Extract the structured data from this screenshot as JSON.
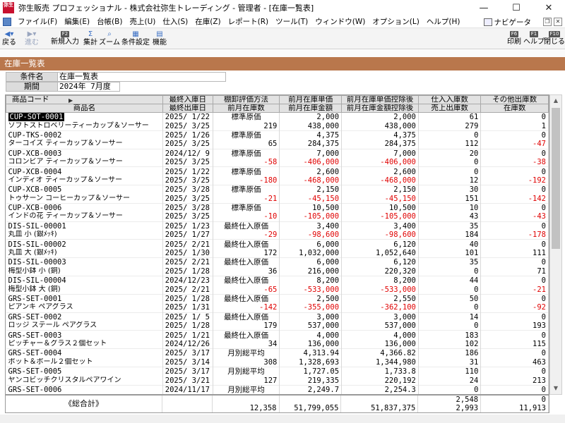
{
  "window": {
    "logo_text": "弥生",
    "title": "弥生販売 プロフェッショナル - 株式会社弥生トレーディング - 管理者 - [在庫一覧表]",
    "minimize": "—",
    "maximize": "☐",
    "close": "✕"
  },
  "menu": {
    "items": [
      "ファイル(F)",
      "編集(E)",
      "台帳(B)",
      "売上(U)",
      "仕入(S)",
      "在庫(Z)",
      "レポート(R)",
      "ツール(T)",
      "ウィンドウ(W)",
      "オプション(L)",
      "ヘルプ(H)"
    ],
    "navigator": "ナビゲータ"
  },
  "toolbar": {
    "back": "戻る",
    "forward": "進む",
    "new_key": "F2",
    "new_label": "新規入力",
    "total_label": "集計",
    "zoom_label": "ズーム",
    "cond_label": "条件設定",
    "func_label": "機能",
    "print_key": "F6",
    "print_label": "印刷",
    "help_key": "F1",
    "help_label": "ヘルプ",
    "close_key": "F10",
    "close_label": "閉じる"
  },
  "section": {
    "title": "在庫一覧表"
  },
  "conditions": {
    "name_label": "条件名",
    "name_value": "在庫一覧表",
    "period_label": "期間",
    "period_value": "2024年 7月度"
  },
  "headers": {
    "row1": [
      "商品コード",
      "最終入庫日",
      "棚卸評価方法",
      "前月在庫単価",
      "前月在庫単価控除後",
      "仕入入庫数",
      "その他出庫数"
    ],
    "row2": [
      "商品名",
      "最終出庫日",
      "前月在庫数",
      "前月在庫金額",
      "前月在庫金額控除後",
      "売上出庫数",
      "在庫数"
    ]
  },
  "rows": [
    {
      "code": "CUP-SOT-0001",
      "name": "ソフトストロベリーティーカップ＆ソーサー",
      "in_date": "2025/ 1/22",
      "out_date": "2025/ 3/25",
      "method": "標準原価",
      "qty": "219",
      "unit": "2,000",
      "amount": "438,000",
      "unit_after": "2,000",
      "amount_after": "438,000",
      "purchase": "61",
      "sales": "279",
      "other": "0",
      "stock": "1",
      "qty_neg": false,
      "amt_neg": false,
      "stock_neg": false
    },
    {
      "code": "CUP-TKS-0002",
      "name": "ターコイズ ティーカップ＆ソーサー",
      "in_date": "2025/ 1/26",
      "out_date": "2025/ 3/25",
      "method": "標準原価",
      "qty": "65",
      "unit": "4,375",
      "amount": "284,375",
      "unit_after": "4,375",
      "amount_after": "284,375",
      "purchase": "0",
      "sales": "112",
      "other": "0",
      "stock": "-47",
      "qty_neg": false,
      "amt_neg": false,
      "stock_neg": true
    },
    {
      "code": "CUP-XCB-0003",
      "name": "コロンビア ティーカップ＆ソーサー",
      "in_date": "2024/12/ 9",
      "out_date": "2025/ 3/25",
      "method": "標準原価",
      "qty": "-58",
      "unit": "7,000",
      "amount": "-406,000",
      "unit_after": "7,000",
      "amount_after": "-406,000",
      "purchase": "20",
      "sales": "0",
      "other": "0",
      "stock": "-38",
      "qty_neg": true,
      "amt_neg": true,
      "stock_neg": true
    },
    {
      "code": "CUP-XCB-0004",
      "name": "インディオ ティーカップ＆ソーサー",
      "in_date": "2025/ 1/22",
      "out_date": "2025/ 3/25",
      "method": "標準原価",
      "qty": "-180",
      "unit": "2,600",
      "amount": "-468,000",
      "unit_after": "2,600",
      "amount_after": "-468,000",
      "purchase": "0",
      "sales": "12",
      "other": "0",
      "stock": "-192",
      "qty_neg": true,
      "amt_neg": true,
      "stock_neg": true
    },
    {
      "code": "CUP-XCB-0005",
      "name": "トゥサーン コーヒーカップ＆ソーサー",
      "in_date": "2025/ 3/28",
      "out_date": "2025/ 3/25",
      "method": "標準原価",
      "qty": "-21",
      "unit": "2,150",
      "amount": "-45,150",
      "unit_after": "2,150",
      "amount_after": "-45,150",
      "purchase": "30",
      "sales": "151",
      "other": "0",
      "stock": "-142",
      "qty_neg": true,
      "amt_neg": true,
      "stock_neg": true
    },
    {
      "code": "CUP-XCB-0006",
      "name": "インドの花 ティーカップ＆ソーサー",
      "in_date": "2025/ 3/28",
      "out_date": "2025/ 3/25",
      "method": "標準原価",
      "qty": "-10",
      "unit": "10,500",
      "amount": "-105,000",
      "unit_after": "10,500",
      "amount_after": "-105,000",
      "purchase": "10",
      "sales": "43",
      "other": "0",
      "stock": "-43",
      "qty_neg": true,
      "amt_neg": true,
      "stock_neg": true
    },
    {
      "code": "DIS-SIL-00001",
      "name": "丸皿 小 (銀ﾒｯｷ)",
      "in_date": "2025/ 1/23",
      "out_date": "2025/ 1/27",
      "method": "最終仕入原価",
      "qty": "-29",
      "unit": "3,400",
      "amount": "-98,600",
      "unit_after": "3,400",
      "amount_after": "-98,600",
      "purchase": "35",
      "sales": "184",
      "other": "0",
      "stock": "-178",
      "qty_neg": true,
      "amt_neg": true,
      "stock_neg": true
    },
    {
      "code": "DIS-SIL-00002",
      "name": "丸皿 大 (銀ﾒｯｷ)",
      "in_date": "2025/ 2/21",
      "out_date": "2025/ 1/30",
      "method": "最終仕入原価",
      "qty": "172",
      "unit": "6,000",
      "amount": "1,032,000",
      "unit_after": "6,120",
      "amount_after": "1,052,640",
      "purchase": "40",
      "sales": "101",
      "other": "0",
      "stock": "111",
      "qty_neg": false,
      "amt_neg": false,
      "stock_neg": false
    },
    {
      "code": "DIS-SIL-00003",
      "name": "梅型小鉢 小 (銅)",
      "in_date": "2025/ 2/21",
      "out_date": "2025/ 1/28",
      "method": "最終仕入原価",
      "qty": "36",
      "unit": "6,000",
      "amount": "216,000",
      "unit_after": "6,120",
      "amount_after": "220,320",
      "purchase": "35",
      "sales": "0",
      "other": "0",
      "stock": "71",
      "qty_neg": false,
      "amt_neg": false,
      "stock_neg": false
    },
    {
      "code": "DIS-SIL-00004",
      "name": "梅型小鉢 大 (銅)",
      "in_date": "2024/12/23",
      "out_date": "2025/ 2/21",
      "method": "最終仕入原価",
      "qty": "-65",
      "unit": "8,200",
      "amount": "-533,000",
      "unit_after": "8,200",
      "amount_after": "-533,000",
      "purchase": "44",
      "sales": "0",
      "other": "0",
      "stock": "-21",
      "qty_neg": true,
      "amt_neg": true,
      "stock_neg": true
    },
    {
      "code": "GRS-SET-0001",
      "name": "ピアンキ ペアグラス",
      "in_date": "2025/ 1/28",
      "out_date": "2025/ 1/31",
      "method": "最終仕入原価",
      "qty": "-142",
      "unit": "2,500",
      "amount": "-355,000",
      "unit_after": "2,550",
      "amount_after": "-362,100",
      "purchase": "50",
      "sales": "0",
      "other": "0",
      "stock": "-92",
      "qty_neg": true,
      "amt_neg": true,
      "stock_neg": true
    },
    {
      "code": "GRS-SET-0002",
      "name": "ロッジ ステール ペアグラス",
      "in_date": "2025/ 1/ 5",
      "out_date": "2025/ 1/28",
      "method": "最終仕入原価",
      "qty": "179",
      "unit": "3,000",
      "amount": "537,000",
      "unit_after": "3,000",
      "amount_after": "537,000",
      "purchase": "14",
      "sales": "0",
      "other": "0",
      "stock": "193",
      "qty_neg": false,
      "amt_neg": false,
      "stock_neg": false
    },
    {
      "code": "GRS-SET-0003",
      "name": "ピッチャー＆グラス２個セット",
      "in_date": "2025/ 1/21",
      "out_date": "2024/12/26",
      "method": "最終仕入原価",
      "qty": "34",
      "unit": "4,000",
      "amount": "136,000",
      "unit_after": "4,000",
      "amount_after": "136,000",
      "purchase": "183",
      "sales": "102",
      "other": "0",
      "stock": "115",
      "qty_neg": false,
      "amt_neg": false,
      "stock_neg": false
    },
    {
      "code": "GRS-SET-0004",
      "name": "ポット＆ボール２個セット",
      "in_date": "2025/ 3/17",
      "out_date": "2025/ 3/14",
      "method": "月別総平均",
      "qty": "308",
      "unit": "4,313.94",
      "amount": "1,328,693",
      "unit_after": "4,366.82",
      "amount_after": "1,344,980",
      "purchase": "186",
      "sales": "31",
      "other": "0",
      "stock": "463",
      "qty_neg": false,
      "amt_neg": false,
      "stock_neg": false
    },
    {
      "code": "GRS-SET-0005",
      "name": "ヤンコビッチクリスタルペアワイン",
      "in_date": "2025/ 3/17",
      "out_date": "2025/ 3/21",
      "method": "月別総平均",
      "qty": "127",
      "unit": "1,727.05",
      "amount": "219,335",
      "unit_after": "1,733.8",
      "amount_after": "220,192",
      "purchase": "110",
      "sales": "24",
      "other": "0",
      "stock": "213",
      "qty_neg": false,
      "amt_neg": false,
      "stock_neg": false
    },
    {
      "code": "GRS-SET-0006",
      "name": "",
      "in_date": "2024/11/17",
      "out_date": "",
      "method": "月別総平均",
      "qty": "",
      "unit": "2,249.7",
      "amount": "",
      "unit_after": "2,254.3",
      "amount_after": "",
      "purchase": "0",
      "sales": "",
      "other": "0",
      "stock": "",
      "qty_neg": false,
      "amt_neg": false,
      "stock_neg": false
    }
  ],
  "totals": {
    "label": "《総合計》",
    "qty": "12,358",
    "amount": "51,799,055",
    "amount_after": "51,837,375",
    "purchase": "2,548",
    "sales": "2,993",
    "other": "0",
    "stock": "11,913"
  }
}
